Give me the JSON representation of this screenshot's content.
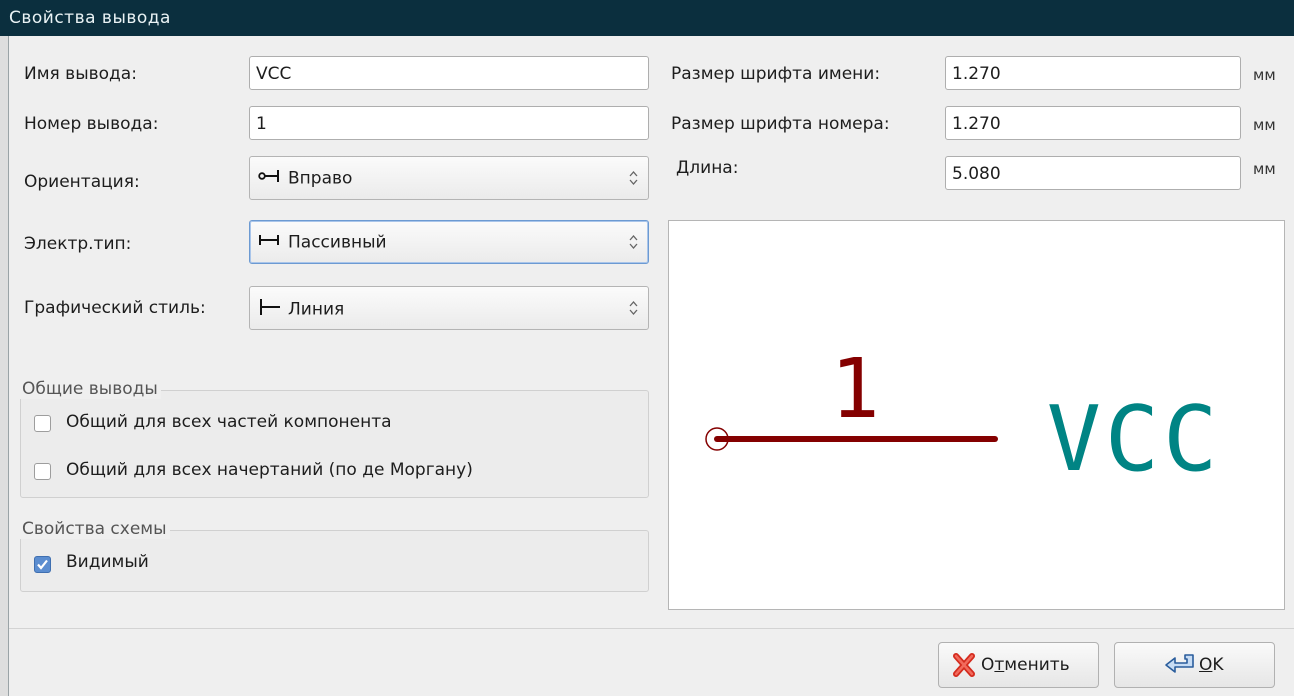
{
  "window": {
    "title": "Свойства вывода"
  },
  "left": {
    "pin_name_label": "Имя вывода:",
    "pin_name_value": "VCC",
    "pin_number_label": "Номер вывода:",
    "pin_number_value": "1",
    "orientation_label": "Ориентация:",
    "orientation_value": "Вправо",
    "electrical_type_label": "Электр.тип:",
    "electrical_type_value": "Пассивный",
    "graphic_style_label": "Графический стиль:",
    "graphic_style_value": "Линия"
  },
  "right": {
    "name_font_label": "Размер шрифта имени:",
    "name_font_value": "1.270",
    "name_font_unit": "мм",
    "number_font_label": "Размер шрифта номера:",
    "number_font_value": "1.270",
    "number_font_unit": "мм",
    "length_label": "Длина:",
    "length_value": "5.080",
    "length_unit": "мм"
  },
  "shared_group": {
    "title": "Общие выводы",
    "items": [
      {
        "label": "Общий для всех частей компонента",
        "checked": false
      },
      {
        "label": "Общий для всех начертаний (по де Моргану)",
        "checked": false
      }
    ]
  },
  "schematic_group": {
    "title": "Свойства схемы",
    "items": [
      {
        "label": "Видимый",
        "checked": true
      }
    ]
  },
  "preview": {
    "pin_number": "1",
    "pin_name": "VCC",
    "pin_color": "#840000",
    "name_color": "#008484"
  },
  "buttons": {
    "cancel_prefix": "О",
    "cancel_accel": "т",
    "cancel_rest": "менить",
    "ok_accel": "O",
    "ok_rest": "K"
  },
  "icons": {
    "orientation": "pin-right-icon",
    "electrical_type": "passive-type-icon",
    "graphic_style": "line-style-icon",
    "cancel": "cancel-x-icon",
    "ok": "ok-arrow-icon"
  }
}
